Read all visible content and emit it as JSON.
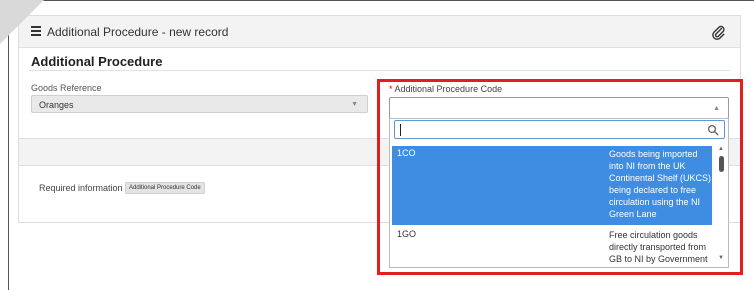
{
  "header": {
    "title": "Additional Procedure - new record",
    "menu_icon": "hamburger-menu-icon",
    "attach_icon": "paperclip-icon"
  },
  "section": {
    "title": "Additional Procedure"
  },
  "goods_reference": {
    "label": "Goods Reference",
    "value": "Oranges"
  },
  "additional_procedure_code": {
    "required_mark": "*",
    "label": "Additional Procedure Code",
    "value": "",
    "search_value": ""
  },
  "dropdown": {
    "options": [
      {
        "code": "1CO",
        "description": "Goods being imported into NI from the UK Continental Shelf (UKCS) being declared to free circulation using the NI Green Lane",
        "selected": true
      },
      {
        "code": "1GO",
        "description": "Free circulation goods directly transported from GB to NI by Government Departments and Others",
        "selected": false
      }
    ]
  },
  "required_info": {
    "label": "Required information",
    "badge": "Additional Procedure Code"
  },
  "colors": {
    "highlight": "#3f8de3",
    "annotation_border": "#e02020",
    "required": "#dd0000"
  }
}
